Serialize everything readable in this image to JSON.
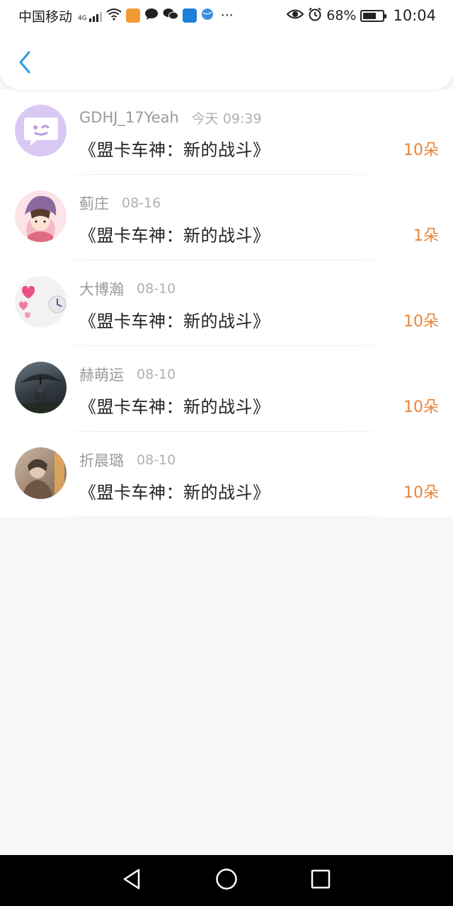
{
  "status_bar": {
    "carrier": "中国移动",
    "network": "4G",
    "more": "···",
    "battery": "68%",
    "battery_level": 0.68,
    "time": "10:04"
  },
  "header": {
    "back_icon": "chevron-left-icon",
    "accent_color": "#2a9de6"
  },
  "records": [
    {
      "name": "GDHJ_17Yeah",
      "date": "今天 09:39",
      "title": "《盟卡车神：新的战斗》",
      "count": "10朵",
      "avatar": "chat-bubble-avatar"
    },
    {
      "name": "蓟庄",
      "date": "08-16",
      "title": "《盟卡车神：新的战斗》",
      "count": "1朵",
      "avatar": "anime-girl-avatar"
    },
    {
      "name": "大博瀚",
      "date": "08-10",
      "title": "《盟卡车神：新的战斗》",
      "count": "10朵",
      "avatar": "hearts-clock-avatar"
    },
    {
      "name": "赫萌运",
      "date": "08-10",
      "title": "《盟卡车神：新的战斗》",
      "count": "10朵",
      "avatar": "rain-umbrella-avatar"
    },
    {
      "name": "折晨璐",
      "date": "08-10",
      "title": "《盟卡车神：新的战斗》",
      "count": "10朵",
      "avatar": "photo-person-avatar"
    }
  ],
  "colors": {
    "count": "#e8843a",
    "background": "#f8f6f7"
  },
  "navbar": {
    "back": "nav-back-icon",
    "home": "nav-home-icon",
    "recents": "nav-recents-icon"
  }
}
